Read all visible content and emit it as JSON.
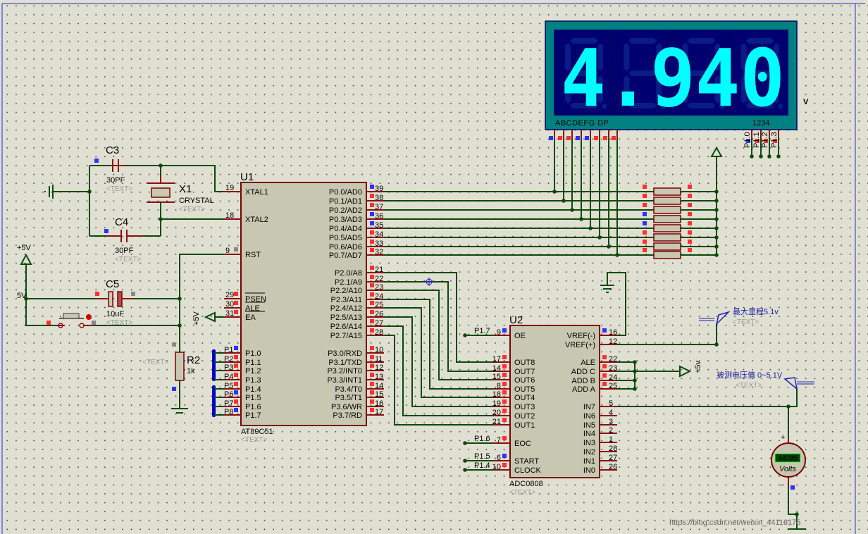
{
  "watermark": "https://blog.csdn.net/weixin_44116175",
  "colors": {
    "wire": "#0b4a0b",
    "pin": "#8a1010",
    "body": "#c8c8b2",
    "outline": "#7a0000",
    "state_high": "#ff3030",
    "state_low": "#3030ff",
    "display_frame": "#008080",
    "display_bg": "#00006e",
    "segment_on": "#00ffff",
    "segment_off": "#0a1c86",
    "unit": "#7a0000",
    "bus": "#0000c8"
  },
  "display": {
    "value": "4.940",
    "segment_labels": "ABCDEFG  DP",
    "digit_labels": "1234",
    "unit": "V",
    "segment_pin_states": [
      "low",
      "high",
      "high",
      "low",
      "low",
      "high",
      "high",
      "high"
    ],
    "digit_pins": [
      {
        "label": "P1.0",
        "state": "low"
      },
      {
        "label": "P1.1",
        "state": "high"
      },
      {
        "label": "P1.2",
        "state": "high"
      },
      {
        "label": "P1.3",
        "state": "high"
      }
    ]
  },
  "u1": {
    "ref": "U1",
    "part": "AT89C51",
    "text": "<TEXT>",
    "left_pins": [
      {
        "name": "XTAL1",
        "num": "19"
      },
      {
        "name": "XTAL2",
        "num": "18"
      },
      {
        "name": "RST",
        "num": "9",
        "state": "gray"
      },
      {
        "name": "PSEN",
        "num": "29",
        "state": "high"
      },
      {
        "name": "ALE",
        "num": "30",
        "state": "high"
      },
      {
        "name": "EA",
        "num": "31",
        "state": "high"
      },
      {
        "name": "P1.0",
        "num": "1",
        "net": "P1",
        "state": "low"
      },
      {
        "name": "P1.1",
        "num": "2",
        "net": "P2",
        "state": "high"
      },
      {
        "name": "P1.2",
        "num": "3",
        "net": "P3",
        "state": "high"
      },
      {
        "name": "P1.3",
        "num": "4",
        "net": "P4",
        "state": "high"
      },
      {
        "name": "P1.4",
        "num": "5",
        "net": "P5",
        "state": "high"
      },
      {
        "name": "P1.5",
        "num": "6",
        "net": "P6",
        "state": "low"
      },
      {
        "name": "P1.6",
        "num": "7",
        "net": "P7",
        "state": "high"
      },
      {
        "name": "P1.7",
        "num": "8",
        "net": "P8",
        "state": "low"
      }
    ],
    "right_pins": [
      {
        "name": "P0.0/AD0",
        "num": "39",
        "state": "low"
      },
      {
        "name": "P0.1/AD1",
        "num": "38",
        "state": "high"
      },
      {
        "name": "P0.2/AD2",
        "num": "37",
        "state": "high"
      },
      {
        "name": "P0.3/AD3",
        "num": "36",
        "state": "low"
      },
      {
        "name": "P0.4/AD4",
        "num": "35",
        "state": "low"
      },
      {
        "name": "P0.5/AD5",
        "num": "34",
        "state": "high"
      },
      {
        "name": "P0.6/AD6",
        "num": "33",
        "state": "high"
      },
      {
        "name": "P0.7/AD7",
        "num": "32",
        "state": "high"
      },
      {
        "name": "P2.0/A8",
        "num": "21",
        "state": "high"
      },
      {
        "name": "P2.1/A9",
        "num": "22",
        "state": "high"
      },
      {
        "name": "P2.2/A10",
        "num": "23",
        "state": "high"
      },
      {
        "name": "P2.3/A11",
        "num": "24",
        "state": "high"
      },
      {
        "name": "P2.4/A12",
        "num": "25",
        "state": "high"
      },
      {
        "name": "P2.5/A13",
        "num": "26",
        "state": "high"
      },
      {
        "name": "P2.6/A14",
        "num": "27",
        "state": "high"
      },
      {
        "name": "P2.7/A15",
        "num": "28",
        "state": "high"
      },
      {
        "name": "P3.0/RXD",
        "num": "10",
        "state": "high"
      },
      {
        "name": "P3.1/TXD",
        "num": "11",
        "state": "high"
      },
      {
        "name": "P3.2/INT0",
        "num": "12",
        "state": "high"
      },
      {
        "name": "P3.3/INT1",
        "num": "13",
        "state": "high"
      },
      {
        "name": "P3.4/T0",
        "num": "14",
        "state": "high"
      },
      {
        "name": "P3.5/T1",
        "num": "15",
        "state": "high"
      },
      {
        "name": "P3.6/WR",
        "num": "16",
        "state": "high"
      },
      {
        "name": "P3.7/RD",
        "num": "17",
        "state": "high"
      }
    ]
  },
  "u2": {
    "ref": "U2",
    "part": "ADC0808",
    "text": "<TEXT>",
    "left_pins": [
      {
        "name": "OE",
        "num": "9",
        "net": "P1.7",
        "state": "low"
      },
      {
        "name": "OUT8",
        "num": "17",
        "state": "high"
      },
      {
        "name": "OUT7",
        "num": "14",
        "state": "high"
      },
      {
        "name": "OUT6",
        "num": "15",
        "state": "high"
      },
      {
        "name": "OUT5",
        "num": "8",
        "state": "high"
      },
      {
        "name": "OUT4",
        "num": "18",
        "state": "high"
      },
      {
        "name": "OUT3",
        "num": "19",
        "state": "high"
      },
      {
        "name": "OUT2",
        "num": "20",
        "state": "high"
      },
      {
        "name": "OUT1",
        "num": "21",
        "state": "high"
      },
      {
        "name": "EOC",
        "num": "7",
        "net": "P1.6",
        "state": "high"
      },
      {
        "name": "START",
        "num": "6",
        "net": "P1.5",
        "state": "low"
      },
      {
        "name": "CLOCK",
        "num": "10",
        "net": "P1.4",
        "state": "high"
      }
    ],
    "right_pins": [
      {
        "name": "VREF(-)",
        "num": "16",
        "state": "low"
      },
      {
        "name": "VREF(+)",
        "num": "12"
      },
      {
        "name": "ALE",
        "num": "22",
        "state": "high"
      },
      {
        "name": "ADD C",
        "num": "23",
        "state": "high"
      },
      {
        "name": "ADD B",
        "num": "24",
        "state": "high"
      },
      {
        "name": "ADD A",
        "num": "25",
        "state": "high"
      },
      {
        "name": "IN7",
        "num": "5"
      },
      {
        "name": "IN6",
        "num": "4"
      },
      {
        "name": "IN5",
        "num": "3"
      },
      {
        "name": "IN4",
        "num": "2"
      },
      {
        "name": "IN3",
        "num": "1"
      },
      {
        "name": "IN2",
        "num": "28"
      },
      {
        "name": "IN1",
        "num": "27"
      },
      {
        "name": "IN0",
        "num": "26"
      }
    ]
  },
  "components": {
    "c3": {
      "ref": "C3",
      "value": "30PF",
      "text": "<TEXT>"
    },
    "c4": {
      "ref": "C4",
      "value": "30PF",
      "text": "<TEXT>"
    },
    "c5": {
      "ref": "C5",
      "value": "10uF",
      "text": "<TEXT>"
    },
    "x1": {
      "ref": "X1",
      "value": "CRYSTAL",
      "text": "<TEXT>"
    },
    "r2": {
      "ref": "R2",
      "value": "1k",
      "text": "<TEXT>"
    },
    "button": {
      "text": "<TEXT>"
    }
  },
  "power": {
    "vcc_label": "+5V",
    "vcc_net": "5V",
    "ea_label": "+5V",
    "adc_label": "+5v"
  },
  "terminals": {
    "vref": {
      "label": "最大里程5.1v",
      "text": "<TEXT>"
    },
    "input": {
      "label": "被测电压值 0~5.1V",
      "text": "<TEXT>"
    }
  },
  "voltmeter": {
    "reading": "+4.95",
    "unit": "Volts",
    "plus": "+",
    "minus": "−"
  }
}
